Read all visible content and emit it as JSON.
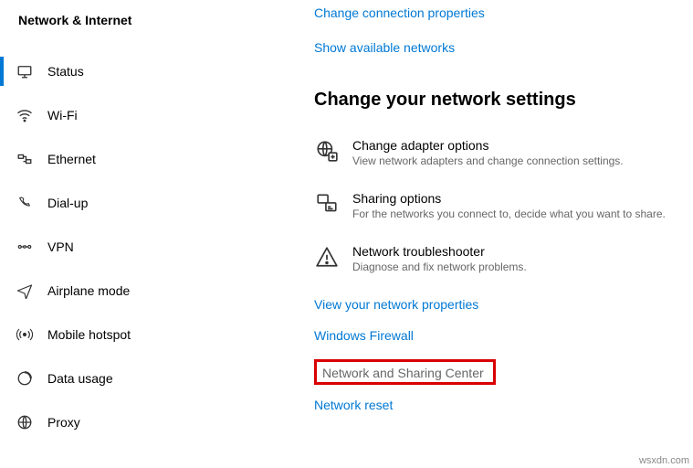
{
  "sidebar": {
    "header": "Network & Internet",
    "items": [
      {
        "label": "Status",
        "active": true
      },
      {
        "label": "Wi-Fi",
        "active": false
      },
      {
        "label": "Ethernet",
        "active": false
      },
      {
        "label": "Dial-up",
        "active": false
      },
      {
        "label": "VPN",
        "active": false
      },
      {
        "label": "Airplane mode",
        "active": false
      },
      {
        "label": "Mobile hotspot",
        "active": false
      },
      {
        "label": "Data usage",
        "active": false
      },
      {
        "label": "Proxy",
        "active": false
      }
    ]
  },
  "main": {
    "top_links": {
      "change_conn": "Change connection properties",
      "show_avail": "Show available networks"
    },
    "section_heading": "Change your network settings",
    "options": [
      {
        "title": "Change adapter options",
        "desc": "View network adapters and change connection settings."
      },
      {
        "title": "Sharing options",
        "desc": "For the networks you connect to, decide what you want to share."
      },
      {
        "title": "Network troubleshooter",
        "desc": "Diagnose and fix network problems."
      }
    ],
    "links": {
      "view_props": "View your network properties",
      "firewall": "Windows Firewall",
      "sharing_center": "Network and Sharing Center",
      "reset": "Network reset"
    },
    "highlight_color": "#d80000",
    "accent_color": "#0078d4"
  },
  "watermark": "wsxdn.com"
}
